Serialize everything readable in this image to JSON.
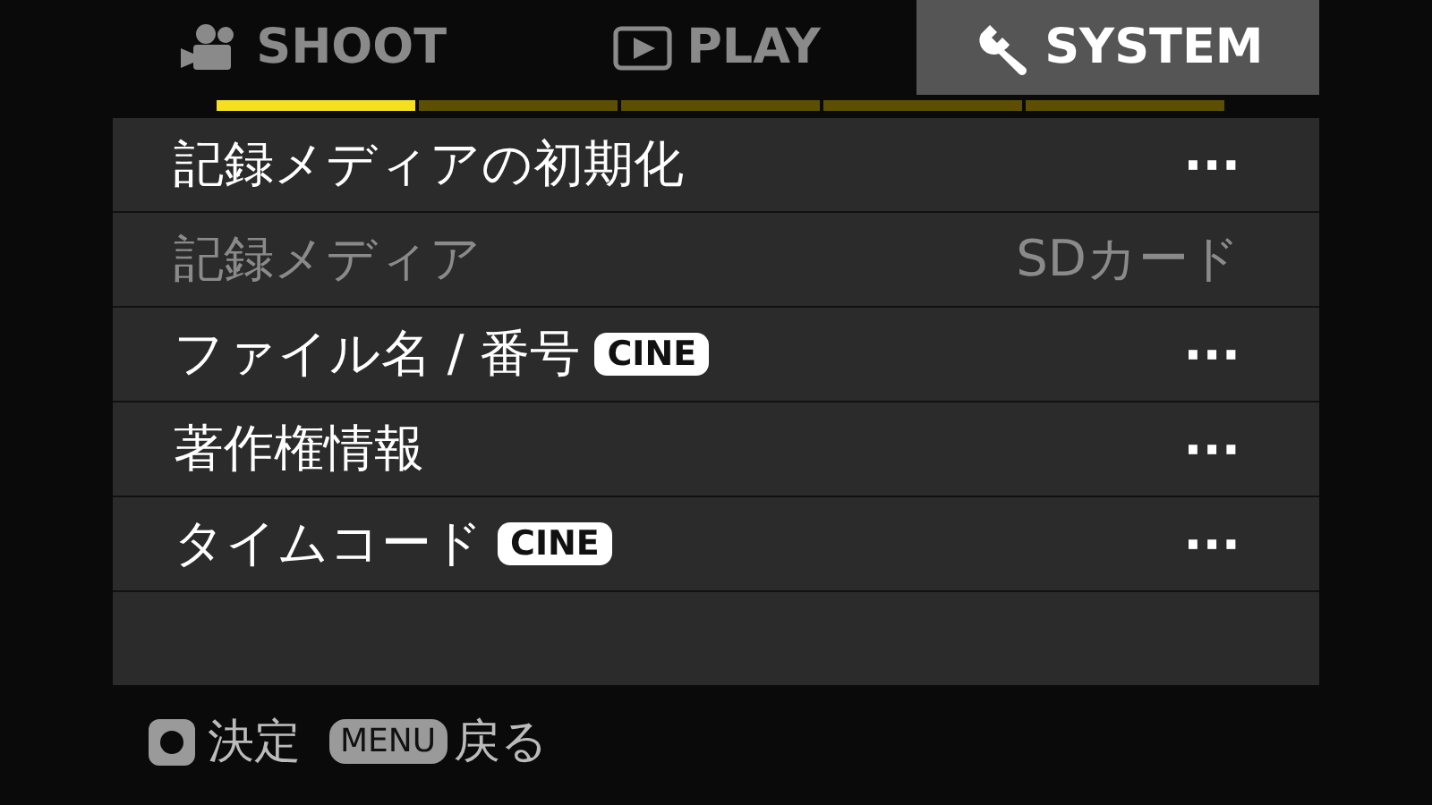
{
  "tabs": [
    {
      "label": "SHOOT",
      "selected": false
    },
    {
      "label": "PLAY",
      "selected": false
    },
    {
      "label": "SYSTEM",
      "selected": true
    }
  ],
  "pages": [
    {
      "selected": true
    },
    {
      "selected": false
    },
    {
      "selected": false
    },
    {
      "selected": false
    },
    {
      "selected": false
    }
  ],
  "menu_items": [
    {
      "label": "記録メディアの初期化",
      "value": "···",
      "disabled": false
    },
    {
      "label": "記録メディア",
      "value": "SDカード",
      "disabled": true
    },
    {
      "label": "ファイル名 / 番号",
      "badge": "CINE",
      "value": "···",
      "disabled": false
    },
    {
      "label": "著作権情報",
      "value": "···",
      "disabled": false
    },
    {
      "label": "タイムコード",
      "badge": "CINE",
      "value": "···",
      "disabled": false
    }
  ],
  "footer": [
    {
      "kind": "icon",
      "label": "決定"
    },
    {
      "kind": "key",
      "key": "MENU",
      "label": "戻る"
    }
  ]
}
